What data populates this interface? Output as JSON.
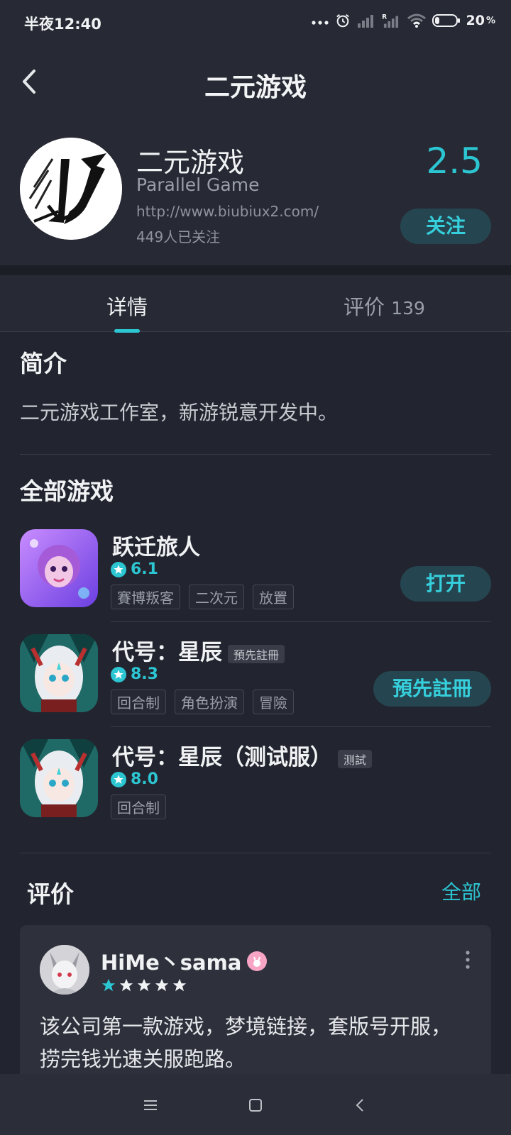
{
  "status_bar": {
    "time": "半夜12:40",
    "battery": "20",
    "battery_unit": "%"
  },
  "header": {
    "title": "二元游戏"
  },
  "developer": {
    "name": "二元游戏",
    "name_en": "Parallel Game",
    "url": "http://www.biubiux2.com/",
    "followers": "449人已关注",
    "score": "2.5",
    "follow_label": "关注"
  },
  "tabs": [
    {
      "label": "详情"
    },
    {
      "label": "评价",
      "count": "139"
    }
  ],
  "intro": {
    "title": "简介",
    "text": "二元游戏工作室，新游锐意开发中。"
  },
  "games_section": {
    "title": "全部游戏",
    "games": [
      {
        "name": "跃迁旅人",
        "badge": "",
        "rating": "6.1",
        "tags": [
          "賽博叛客",
          "二次元",
          "放置"
        ],
        "button": "打开"
      },
      {
        "name": "代号：星辰",
        "badge": "預先註冊",
        "rating": "8.3",
        "tags": [
          "回合制",
          "角色扮演",
          "冒險"
        ],
        "button": "預先註冊"
      },
      {
        "name": "代号：星辰（测试服）",
        "badge": "测試",
        "rating": "8.0",
        "tags": [
          "回合制"
        ],
        "button": ""
      }
    ]
  },
  "reviews": {
    "title": "评价",
    "all_label": "全部",
    "items": [
      {
        "user": "HiMe丶sama",
        "stars": 1,
        "max_stars": 5,
        "text": "该公司第一款游戏，梦境链接，套版号开服，捞完钱光速关服跑路。"
      }
    ]
  },
  "colors": {
    "accent": "#2cc5d2",
    "background": "#22252f",
    "panel": "#272a34",
    "card": "#2e313c"
  }
}
